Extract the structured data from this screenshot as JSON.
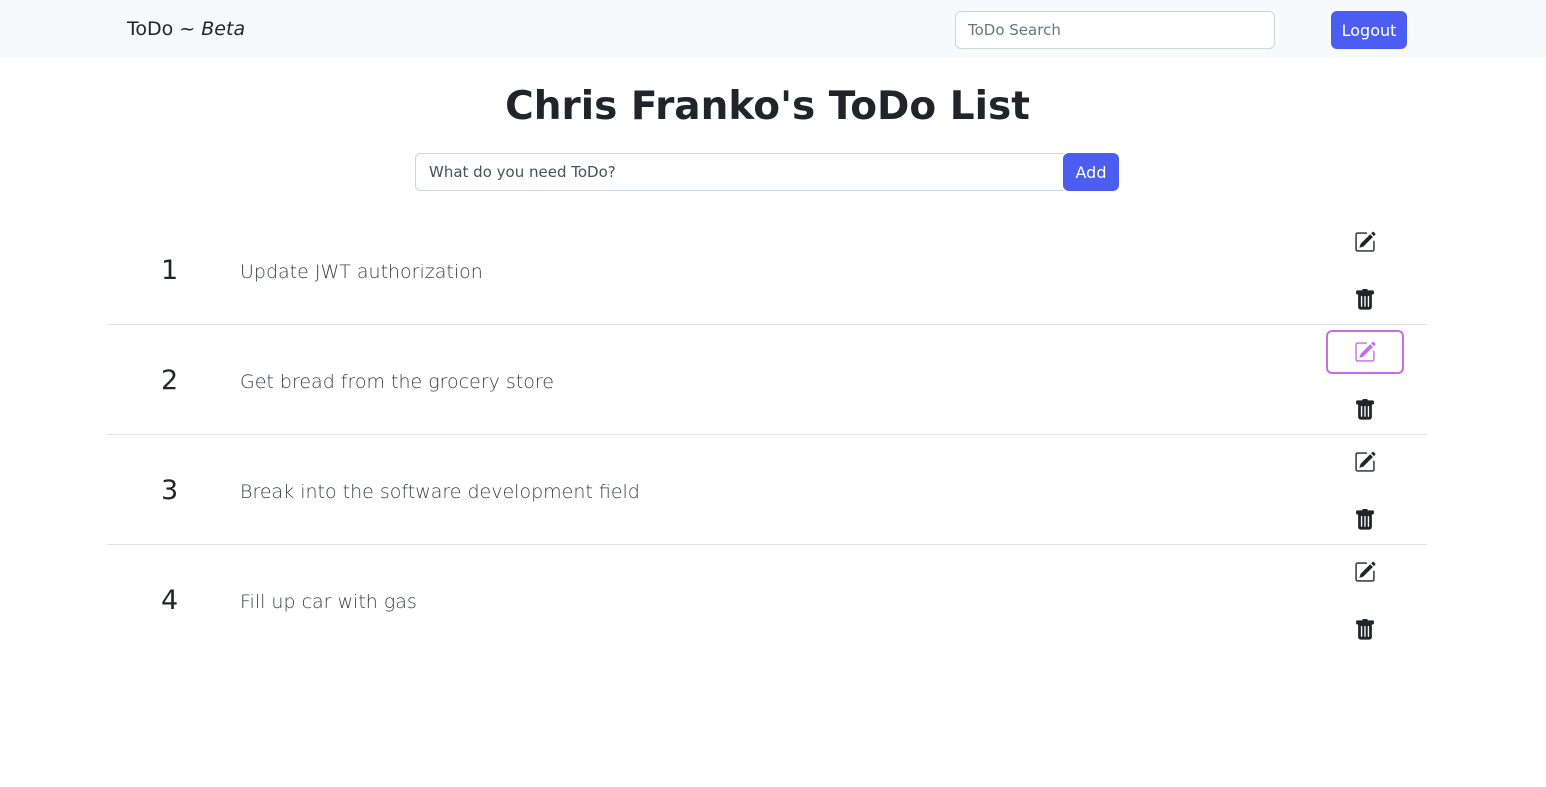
{
  "navbar": {
    "brand_main": "ToDo ~ ",
    "brand_italic": "Beta",
    "search_placeholder": "ToDo Search",
    "logout_label": "Logout"
  },
  "main": {
    "title": "Chris Franko's ToDo List",
    "add_placeholder": "What do you need ToDo?",
    "add_label": "Add"
  },
  "todos": [
    {
      "number": "1",
      "text": "Update JWT authorization",
      "edit_icon": "pencil-square-icon",
      "delete_icon": "trash-icon"
    },
    {
      "number": "2",
      "text": "Get bread from the grocery store",
      "edit_icon": "pencil-square-icon",
      "delete_icon": "trash-icon",
      "edit_focused": true
    },
    {
      "number": "3",
      "text": "Break into the software development field",
      "edit_icon": "pencil-square-icon",
      "delete_icon": "trash-icon"
    },
    {
      "number": "4",
      "text": "Fill up car with gas",
      "edit_icon": "pencil-square-icon",
      "delete_icon": "trash-icon"
    }
  ],
  "colors": {
    "primary_button": "#4c5ef2",
    "focus_outline": "#c36ee6",
    "icon": "#212529",
    "icon_focused": "#c36ee6"
  }
}
